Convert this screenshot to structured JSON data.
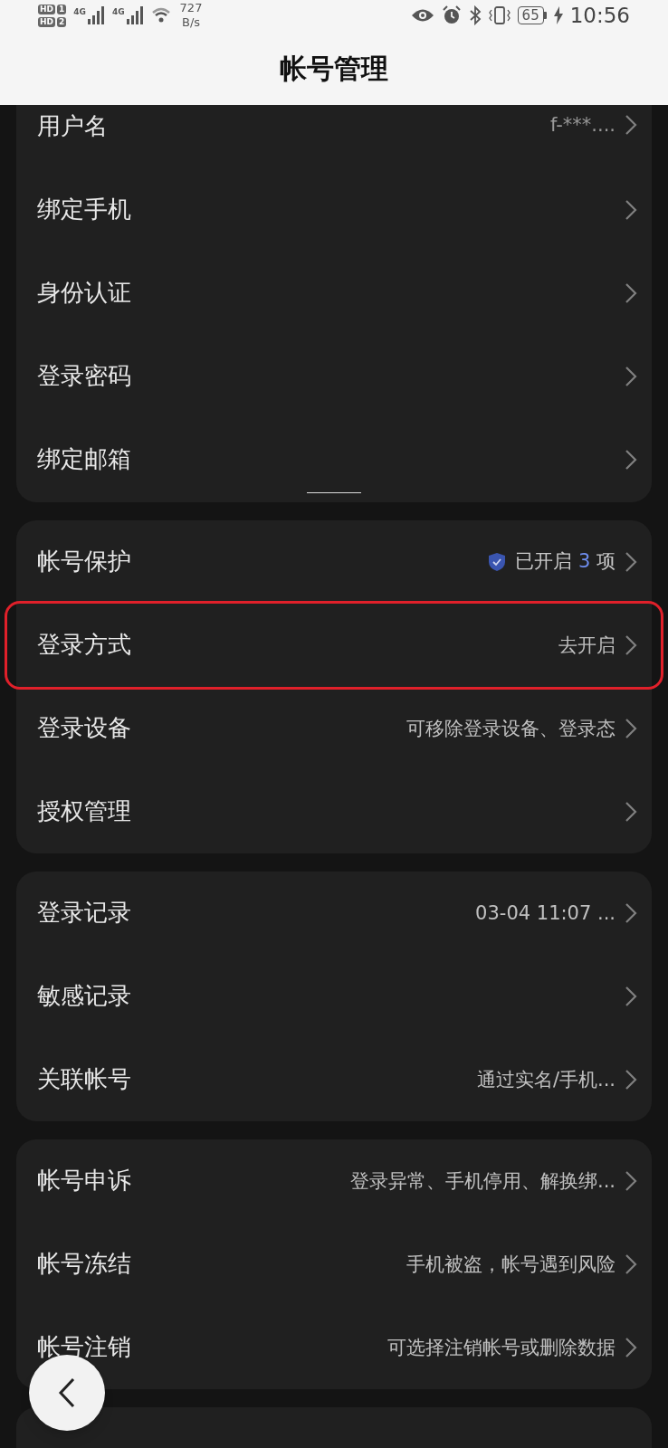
{
  "status_bar": {
    "sim_1": {
      "hd": "HD",
      "slot": "1"
    },
    "sim_2": {
      "hd": "HD",
      "slot": "2"
    },
    "network_1": "4G",
    "network_2": "4G",
    "speed_value": "727",
    "speed_unit": "B/s",
    "battery": "65",
    "time": "10:56"
  },
  "header": {
    "title": "帐号管理"
  },
  "groups": [
    {
      "rows": [
        {
          "label": "用户名",
          "value": "f-***....",
          "dim": true,
          "highlighted": false
        },
        {
          "label": "绑定手机",
          "highlighted": false
        },
        {
          "label": "身份认证",
          "highlighted": false
        },
        {
          "label": "登录密码",
          "highlighted": false
        },
        {
          "label": "绑定邮箱",
          "highlighted": false
        }
      ]
    },
    {
      "rows": [
        {
          "label": "帐号保护",
          "status": {
            "before": "已开启",
            "count": "3",
            "after": "项"
          },
          "highlighted": false
        },
        {
          "label": "登录方式",
          "value": "去开启",
          "highlighted": true
        },
        {
          "label": "登录设备",
          "value": "可移除登录设备、登录态",
          "highlighted": false
        },
        {
          "label": "授权管理",
          "highlighted": false
        }
      ]
    },
    {
      "rows": [
        {
          "label": "登录记录",
          "value": "03-04 11:07 ...",
          "highlighted": false
        },
        {
          "label": "敏感记录",
          "highlighted": false
        },
        {
          "label": "关联帐号",
          "value": "通过实名/手机...",
          "highlighted": false
        }
      ]
    },
    {
      "rows": [
        {
          "label": "帐号申诉",
          "value": "登录异常、手机停用、解换绑...",
          "highlighted": false
        },
        {
          "label": "帐号冻结",
          "value": "手机被盗，帐号遇到风险",
          "highlighted": false
        },
        {
          "label": "帐号注销",
          "value": "可选择注销帐号或删除数据",
          "highlighted": false
        }
      ]
    },
    {
      "kind": "cut"
    }
  ]
}
